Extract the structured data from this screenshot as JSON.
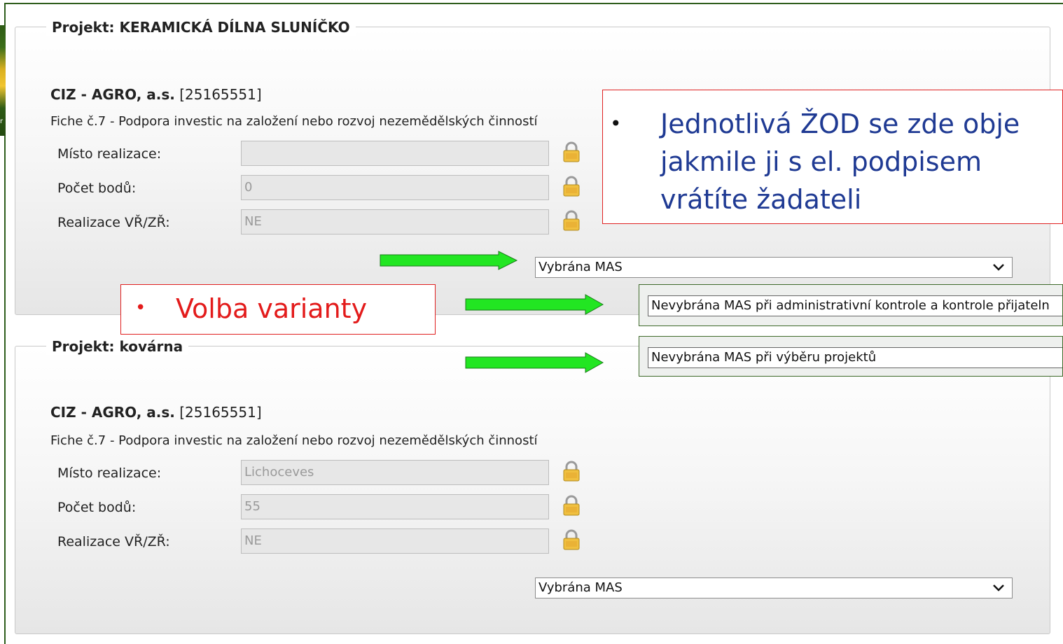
{
  "projects": [
    {
      "legend": "Projekt: KERAMICKÁ DÍLNA SLUNÍČKO",
      "org_name": "CIZ - AGRO, a.s.",
      "org_id": "[25165551]",
      "fiche": "Fiche č.7 - Podpora investic na založení nebo rozvoj nezemědělských činností",
      "place_label": "Místo realizace:",
      "place_value": "",
      "points_label": "Počet bodů:",
      "points_value": "0",
      "vr_label": "Realizace VŘ/ZŘ:",
      "vr_value": "NE",
      "status_select": "Vybrána MAS"
    },
    {
      "legend": "Projekt: kovárna",
      "org_name": "CIZ - AGRO, a.s.",
      "org_id": "[25165551]",
      "fiche": "Fiche č.7 - Podpora investic na založení nebo rozvoj nezemědělských činností",
      "place_label": "Místo realizace:",
      "place_value": "Lichoceves",
      "points_label": "Počet bodů:",
      "points_value": "55",
      "vr_label": "Realizace VŘ/ZŘ:",
      "vr_value": "NE",
      "status_select": "Vybrána MAS"
    }
  ],
  "option_variants": [
    "Nevybrána MAS při administrativní kontrole a kontrole přijateln",
    "Nevybrána MAS při výběru projektů"
  ],
  "callouts": {
    "zod_lines": [
      "Jednotlivá ŽOD se zde obje",
      "jakmile ji s el. podpisem",
      "vrátíte žadateli"
    ],
    "variant": "Volba varianty",
    "bullet": "•"
  },
  "sidebar_letter": "r",
  "colors": {
    "callout_border": "#e02020",
    "callout_text_red": "#e31b1b",
    "arrow_green": "#22e622",
    "frame_green": "#2f5d1c"
  }
}
